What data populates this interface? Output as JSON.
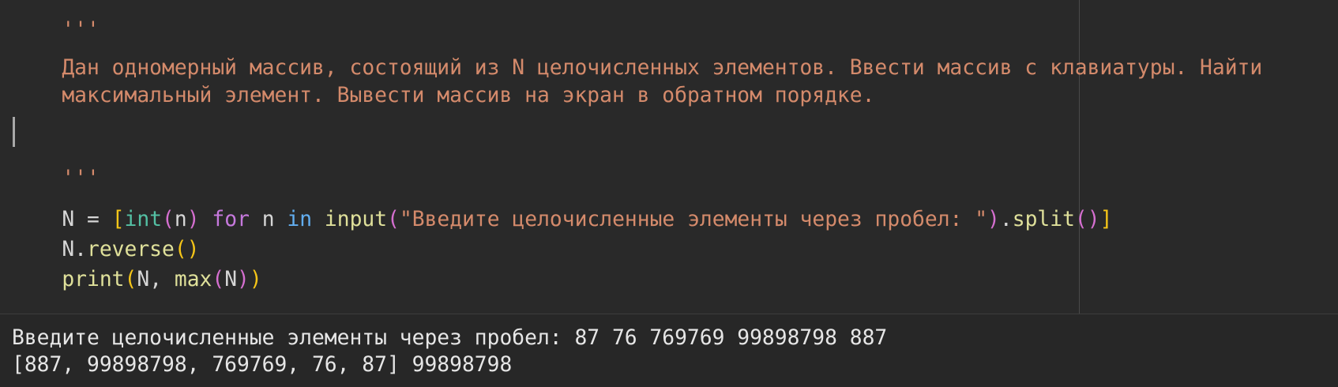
{
  "editor": {
    "lines": {
      "l0": {
        "t0": "'''"
      },
      "l1": {
        "t0": "Дан одномерный массив, состоящий из N целочисленных элементов. Ввести массив с клавиатуры. Найти"
      },
      "l2": {
        "t0": "максимальный элемент. Вывести массив на экран в обратном порядке."
      },
      "l4": {
        "t0": "'''"
      },
      "l5": {
        "t0": "N = ",
        "t1": "[",
        "t2": "int",
        "t3": "(",
        "t4": "n",
        "t5": ")",
        "t6": " ",
        "t7": "for",
        "t8": " n ",
        "t9": "in",
        "t10": " ",
        "t11": "input",
        "t12": "(",
        "t13": "\"Введите целочисленные элементы через пробел: \"",
        "t14": ")",
        "t15": ".",
        "t16": "split",
        "t17": "()",
        "t18": "]"
      },
      "l6": {
        "t0": "N.",
        "t1": "reverse",
        "t2": "()"
      },
      "l7": {
        "t0": "print",
        "t1": "(",
        "t2": "N, ",
        "t3": "max",
        "t4": "(",
        "t5": "N",
        "t6": ")",
        "t7": ")"
      }
    }
  },
  "console": {
    "input_line": "Введите целочисленные элементы через пробел: 87 76 769769 99898798 887",
    "output_line": "[887, 99898798, 769769, 76, 87] 99898798"
  },
  "colors": {
    "background": "#292929",
    "string": "#d48a6b",
    "keyword": "#c679dd",
    "builtin_type": "#54c0a4",
    "function": "#dfe09a",
    "bracket_level1": "#f5c518",
    "bracket_level2": "#d56fd0"
  }
}
